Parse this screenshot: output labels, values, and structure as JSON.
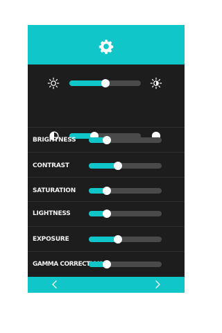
{
  "header": {
    "icon": "gear-icon"
  },
  "top_sliders": [
    {
      "left_icon": "sun-outline-icon",
      "right_icon": "sun-half-icon",
      "value": 0.5
    },
    {
      "left_icon": "contrast-half-circle-icon",
      "right_icon": "full-circle-icon",
      "value": 0.35
    }
  ],
  "adjustments": [
    {
      "label": "BRIGHTNESS",
      "value": 0.25
    },
    {
      "label": "CONTRAST",
      "value": 0.4
    },
    {
      "label": "SATURATION",
      "value": 0.25
    },
    {
      "label": "LIGHTNESS",
      "value": 0.25
    },
    {
      "label": "EXPOSURE",
      "value": 0.4
    },
    {
      "label": "GAMMA CORRECTION",
      "value": 0.25
    }
  ],
  "footer": {
    "prev_icon": "chevron-left-icon",
    "next_icon": "chevron-right-icon"
  },
  "colors": {
    "accent": "#10c6c9",
    "panel": "#1d1d1d",
    "track": "#4a4a4a",
    "knob": "#ffffff"
  }
}
